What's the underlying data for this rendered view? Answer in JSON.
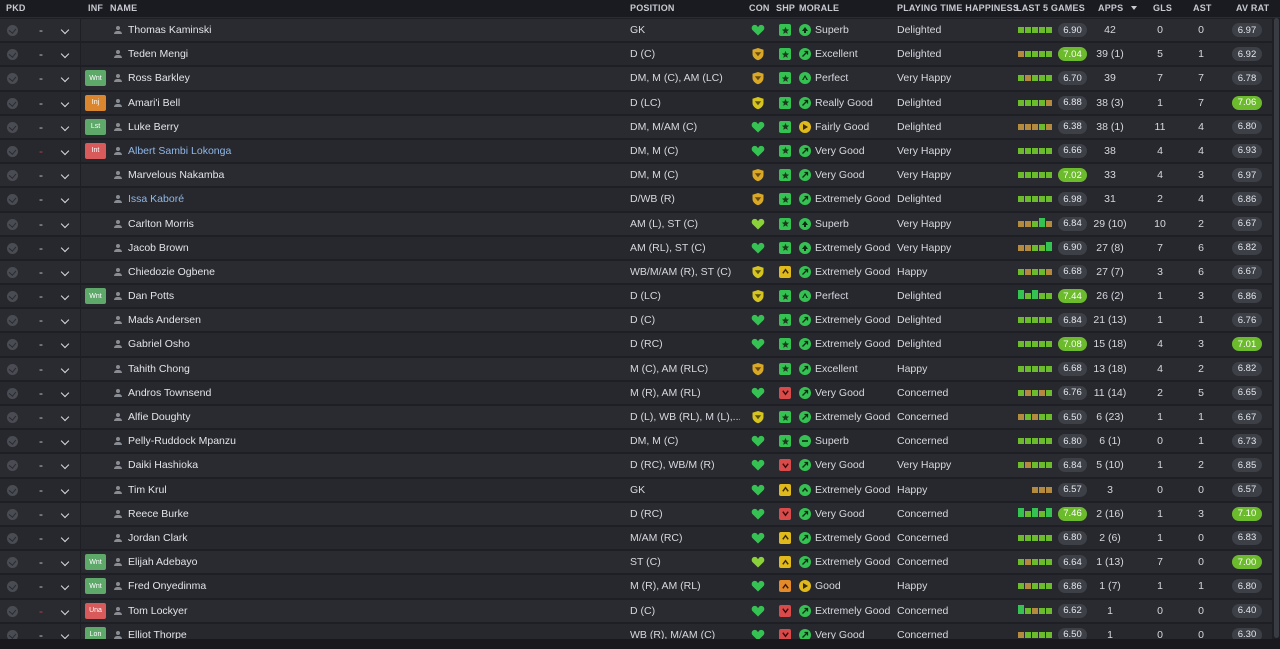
{
  "headers": {
    "pkd": "PKD",
    "inf": "INF",
    "name": "NAME",
    "position": "POSITION",
    "con": "CON",
    "shp": "SHP",
    "morale": "MORALE",
    "pth": "PLAYING TIME HAPPINESS",
    "last5": "LAST 5 GAMES",
    "apps": "APPS",
    "gls": "GLS",
    "ast": "AST",
    "avrat": "AV RAT"
  },
  "colors": {
    "green": "#6cbb2c",
    "bright_green": "#35c253",
    "yellow": "#d8b61a",
    "orange": "#e58a2a",
    "red": "#d94b4b",
    "grey": "#6d6f77",
    "link": "#8fb7e8"
  },
  "players": [
    {
      "pkd_dash": "-",
      "pkd_red": false,
      "inf": "",
      "name": "Thomas Kaminski",
      "link": false,
      "position": "GK",
      "con": "heart",
      "shp": "star-green",
      "morale_icon": "superb",
      "morale": "Superb",
      "pth": "Delighted",
      "form": [
        "g",
        "g",
        "g",
        "g",
        "g"
      ],
      "form_last": "6.90",
      "form_last_green": false,
      "apps": "42",
      "gls": "0",
      "ast": "0",
      "avrat": "6.97",
      "avrat_green": false
    },
    {
      "pkd_dash": "-",
      "pkd_red": false,
      "inf": "",
      "name": "Teden Mengi",
      "link": false,
      "position": "D (C)",
      "con": "shield",
      "shp": "star-green",
      "morale_icon": "good",
      "morale": "Excellent",
      "pth": "Delighted",
      "form": [
        "o",
        "g",
        "g",
        "g",
        "g"
      ],
      "form_last": "7.04",
      "form_last_green": true,
      "apps": "39 (1)",
      "gls": "5",
      "ast": "1",
      "avrat": "6.92",
      "avrat_green": false
    },
    {
      "pkd_dash": "-",
      "pkd_red": false,
      "inf": "Wnt",
      "inf_color": "#5ea86a",
      "name": "Ross Barkley",
      "link": false,
      "position": "DM, M (C), AM (LC)",
      "con": "shield",
      "shp": "star-green",
      "morale_icon": "perfect",
      "morale": "Perfect",
      "pth": "Very Happy",
      "form": [
        "g",
        "o",
        "g",
        "g",
        "g"
      ],
      "form_last": "6.70",
      "form_last_green": false,
      "apps": "39",
      "gls": "7",
      "ast": "7",
      "avrat": "6.78",
      "avrat_green": false
    },
    {
      "pkd_dash": "-",
      "pkd_red": false,
      "inf": "Inj",
      "inf_color": "#d9862f",
      "name": "Amari'i Bell",
      "link": false,
      "position": "D (LC)",
      "con": "shield-y",
      "shp": "star-green",
      "morale_icon": "good",
      "morale": "Really Good",
      "pth": "Delighted",
      "form": [
        "g",
        "g",
        "g",
        "g",
        "o"
      ],
      "form_last": "6.88",
      "form_last_green": false,
      "apps": "38 (3)",
      "gls": "1",
      "ast": "7",
      "avrat": "7.06",
      "avrat_green": true
    },
    {
      "pkd_dash": "-",
      "pkd_red": false,
      "inf": "Lst",
      "inf_color": "#5ea86a",
      "name": "Luke Berry",
      "link": false,
      "position": "DM, M/AM (C)",
      "con": "heart",
      "shp": "star-green",
      "morale_icon": "fairly",
      "morale": "Fairly Good",
      "pth": "Delighted",
      "form": [
        "o",
        "o",
        "o",
        "g",
        "o"
      ],
      "form_last": "6.38",
      "form_last_green": false,
      "apps": "38 (1)",
      "gls": "11",
      "ast": "4",
      "avrat": "6.80",
      "avrat_green": false
    },
    {
      "pkd_dash": "-",
      "pkd_red": true,
      "inf": "Int",
      "inf_color": "#d95a5a",
      "name": "Albert Sambi Lokonga",
      "link": true,
      "position": "DM, M (C)",
      "con": "heart",
      "shp": "star-green",
      "morale_icon": "good",
      "morale": "Very Good",
      "pth": "Very Happy",
      "form": [
        "g",
        "g",
        "g",
        "g",
        "g"
      ],
      "form_last": "6.66",
      "form_last_green": false,
      "apps": "38",
      "gls": "4",
      "ast": "4",
      "avrat": "6.93",
      "avrat_green": false
    },
    {
      "pkd_dash": "-",
      "pkd_red": false,
      "inf": "",
      "name": "Marvelous Nakamba",
      "link": false,
      "position": "DM, M (C)",
      "con": "shield",
      "shp": "star-green",
      "morale_icon": "good",
      "morale": "Very Good",
      "pth": "Very Happy",
      "form": [
        "g",
        "g",
        "g",
        "g",
        "g"
      ],
      "form_last": "7.02",
      "form_last_green": true,
      "apps": "33",
      "gls": "4",
      "ast": "3",
      "avrat": "6.97",
      "avrat_green": false
    },
    {
      "pkd_dash": "-",
      "pkd_red": false,
      "inf": "",
      "name": "Issa Kaboré",
      "link": true,
      "position": "D/WB (R)",
      "con": "shield",
      "shp": "star-green",
      "morale_icon": "good",
      "morale": "Extremely Good",
      "pth": "Delighted",
      "form": [
        "g",
        "g",
        "g",
        "g",
        "g"
      ],
      "form_last": "6.98",
      "form_last_green": false,
      "apps": "31",
      "gls": "2",
      "ast": "4",
      "avrat": "6.86",
      "avrat_green": false
    },
    {
      "pkd_dash": "-",
      "pkd_red": false,
      "inf": "",
      "name": "Carlton Morris",
      "link": false,
      "position": "AM (L), ST (C)",
      "con": "heart-y",
      "shp": "star-green",
      "morale_icon": "superb",
      "morale": "Superb",
      "pth": "Very Happy",
      "form": [
        "o",
        "o",
        "g",
        "G",
        "o"
      ],
      "form_last": "6.84",
      "form_last_green": false,
      "apps": "29 (10)",
      "gls": "10",
      "ast": "2",
      "avrat": "6.67",
      "avrat_green": false
    },
    {
      "pkd_dash": "-",
      "pkd_red": false,
      "inf": "",
      "name": "Jacob Brown",
      "link": false,
      "position": "AM (RL), ST (C)",
      "con": "heart",
      "shp": "star-green",
      "morale_icon": "superb",
      "morale": "Extremely Good",
      "pth": "Very Happy",
      "form": [
        "o",
        "o",
        "g",
        "g",
        "G"
      ],
      "form_last": "6.90",
      "form_last_green": false,
      "apps": "27 (8)",
      "gls": "7",
      "ast": "6",
      "avrat": "6.82",
      "avrat_green": false
    },
    {
      "pkd_dash": "-",
      "pkd_red": false,
      "inf": "",
      "name": "Chiedozie Ogbene",
      "link": false,
      "position": "WB/M/AM (R), ST (C)",
      "con": "shield-y",
      "shp": "up-yellow",
      "morale_icon": "good",
      "morale": "Extremely Good",
      "pth": "Happy",
      "form": [
        "g",
        "o",
        "g",
        "g",
        "o"
      ],
      "form_last": "6.68",
      "form_last_green": false,
      "apps": "27 (7)",
      "gls": "3",
      "ast": "6",
      "avrat": "6.67",
      "avrat_green": false
    },
    {
      "pkd_dash": "-",
      "pkd_red": false,
      "inf": "Wnt",
      "inf_color": "#5ea86a",
      "name": "Dan Potts",
      "link": false,
      "position": "D (LC)",
      "con": "shield-y",
      "shp": "star-green",
      "morale_icon": "perfect",
      "morale": "Perfect",
      "pth": "Delighted",
      "form": [
        "G",
        "g",
        "G",
        "g",
        "g"
      ],
      "form_last": "7.44",
      "form_last_green": true,
      "apps": "26 (2)",
      "gls": "1",
      "ast": "3",
      "avrat": "6.86",
      "avrat_green": false
    },
    {
      "pkd_dash": "-",
      "pkd_red": false,
      "inf": "",
      "name": "Mads Andersen",
      "link": false,
      "position": "D (C)",
      "con": "heart",
      "shp": "star-green",
      "morale_icon": "good",
      "morale": "Extremely Good",
      "pth": "Delighted",
      "form": [
        "g",
        "g",
        "g",
        "g",
        "g"
      ],
      "form_last": "6.84",
      "form_last_green": false,
      "apps": "21 (13)",
      "gls": "1",
      "ast": "1",
      "avrat": "6.76",
      "avrat_green": false
    },
    {
      "pkd_dash": "-",
      "pkd_red": false,
      "inf": "",
      "name": "Gabriel Osho",
      "link": false,
      "position": "D (RC)",
      "con": "heart",
      "shp": "star-green",
      "morale_icon": "good",
      "morale": "Extremely Good",
      "pth": "Delighted",
      "form": [
        "g",
        "g",
        "g",
        "g",
        "g"
      ],
      "form_last": "7.08",
      "form_last_green": true,
      "apps": "15 (18)",
      "gls": "4",
      "ast": "3",
      "avrat": "7.01",
      "avrat_green": true
    },
    {
      "pkd_dash": "-",
      "pkd_red": false,
      "inf": "",
      "name": "Tahith Chong",
      "link": false,
      "position": "M (C), AM (RLC)",
      "con": "shield",
      "shp": "star-green",
      "morale_icon": "good",
      "morale": "Excellent",
      "pth": "Happy",
      "form": [
        "g",
        "g",
        "g",
        "g",
        "g"
      ],
      "form_last": "6.68",
      "form_last_green": false,
      "apps": "13 (18)",
      "gls": "4",
      "ast": "2",
      "avrat": "6.82",
      "avrat_green": false
    },
    {
      "pkd_dash": "-",
      "pkd_red": false,
      "inf": "",
      "name": "Andros Townsend",
      "link": false,
      "position": "M (R), AM (RL)",
      "con": "heart",
      "shp": "down-red",
      "morale_icon": "good",
      "morale": "Very Good",
      "pth": "Concerned",
      "form": [
        "g",
        "o",
        "g",
        "o",
        "g"
      ],
      "form_last": "6.76",
      "form_last_green": false,
      "apps": "11 (14)",
      "gls": "2",
      "ast": "5",
      "avrat": "6.65",
      "avrat_green": false
    },
    {
      "pkd_dash": "-",
      "pkd_red": false,
      "inf": "",
      "name": "Alfie Doughty",
      "link": false,
      "position": "D (L), WB (RL), M (L),...",
      "con": "shield-y",
      "shp": "star-green",
      "morale_icon": "good",
      "morale": "Extremely Good",
      "pth": "Concerned",
      "form": [
        "o",
        "g",
        "o",
        "g",
        "g"
      ],
      "form_last": "6.50",
      "form_last_green": false,
      "apps": "6 (23)",
      "gls": "1",
      "ast": "1",
      "avrat": "6.67",
      "avrat_green": false
    },
    {
      "pkd_dash": "-",
      "pkd_red": false,
      "inf": "",
      "name": "Pelly-Ruddock Mpanzu",
      "link": false,
      "position": "DM, M (C)",
      "con": "heart",
      "shp": "star-green",
      "morale_icon": "neutral",
      "morale": "Superb",
      "pth": "Concerned",
      "form": [
        "g",
        "g",
        "g",
        "g",
        "g"
      ],
      "form_last": "6.80",
      "form_last_green": false,
      "apps": "6 (1)",
      "gls": "0",
      "ast": "1",
      "avrat": "6.73",
      "avrat_green": false
    },
    {
      "pkd_dash": "-",
      "pkd_red": false,
      "inf": "",
      "name": "Daiki Hashioka",
      "link": false,
      "position": "D (RC), WB/M (R)",
      "con": "heart",
      "shp": "down-red",
      "morale_icon": "good",
      "morale": "Very Good",
      "pth": "Very Happy",
      "form": [
        "g",
        "o",
        "g",
        "g",
        "g"
      ],
      "form_last": "6.84",
      "form_last_green": false,
      "apps": "5 (10)",
      "gls": "1",
      "ast": "2",
      "avrat": "6.85",
      "avrat_green": false
    },
    {
      "pkd_dash": "-",
      "pkd_red": false,
      "inf": "",
      "name": "Tim Krul",
      "link": false,
      "position": "GK",
      "con": "heart",
      "shp": "up-yellow",
      "morale_icon": "up-o",
      "morale": "Extremely Good",
      "pth": "Happy",
      "form": [
        "o",
        "o",
        "o"
      ],
      "form_last": "6.57",
      "form_last_green": false,
      "apps": "3",
      "gls": "0",
      "ast": "0",
      "avrat": "6.57",
      "avrat_green": false
    },
    {
      "pkd_dash": "-",
      "pkd_red": false,
      "inf": "",
      "name": "Reece Burke",
      "link": false,
      "position": "D (RC)",
      "con": "heart",
      "shp": "down-red",
      "morale_icon": "good",
      "morale": "Very Good",
      "pth": "Concerned",
      "form": [
        "G",
        "g",
        "G",
        "g",
        "G"
      ],
      "form_last": "7.46",
      "form_last_green": true,
      "apps": "2 (16)",
      "gls": "1",
      "ast": "3",
      "avrat": "7.10",
      "avrat_green": true
    },
    {
      "pkd_dash": "-",
      "pkd_red": false,
      "inf": "",
      "name": "Jordan Clark",
      "link": false,
      "position": "M/AM (RC)",
      "con": "heart",
      "shp": "up-yellow",
      "morale_icon": "good",
      "morale": "Extremely Good",
      "pth": "Concerned",
      "form": [
        "g",
        "g",
        "g",
        "g",
        "g"
      ],
      "form_last": "6.80",
      "form_last_green": false,
      "apps": "2 (6)",
      "gls": "1",
      "ast": "0",
      "avrat": "6.83",
      "avrat_green": false
    },
    {
      "pkd_dash": "-",
      "pkd_red": false,
      "inf": "Wnt",
      "inf_color": "#5ea86a",
      "name": "Elijah Adebayo",
      "link": false,
      "position": "ST (C)",
      "con": "heart-y",
      "shp": "up-yellow",
      "morale_icon": "good",
      "morale": "Extremely Good",
      "pth": "Concerned",
      "form": [
        "g",
        "o",
        "g",
        "g",
        "g"
      ],
      "form_last": "6.64",
      "form_last_green": false,
      "apps": "1 (13)",
      "gls": "7",
      "ast": "0",
      "avrat": "7.00",
      "avrat_green": true
    },
    {
      "pkd_dash": "-",
      "pkd_red": false,
      "inf": "Wnt",
      "inf_color": "#5ea86a",
      "name": "Fred Onyedinma",
      "link": false,
      "position": "M (R), AM (RL)",
      "con": "heart",
      "shp": "up-orange",
      "morale_icon": "fairly",
      "morale": "Good",
      "pth": "Happy",
      "form": [
        "g",
        "o",
        "g",
        "g",
        "g"
      ],
      "form_last": "6.86",
      "form_last_green": false,
      "apps": "1 (7)",
      "gls": "1",
      "ast": "1",
      "avrat": "6.80",
      "avrat_green": false
    },
    {
      "pkd_dash": "-",
      "pkd_red": true,
      "inf": "Una",
      "inf_color": "#d95a5a",
      "name": "Tom Lockyer",
      "link": false,
      "position": "D (C)",
      "con": "heart",
      "shp": "down-red",
      "morale_icon": "good",
      "morale": "Extremely Good",
      "pth": "Concerned",
      "form": [
        "G",
        "g",
        "o",
        "g",
        "g"
      ],
      "form_last": "6.62",
      "form_last_green": false,
      "apps": "1",
      "gls": "0",
      "ast": "0",
      "avrat": "6.40",
      "avrat_green": false
    },
    {
      "pkd_dash": "-",
      "pkd_red": false,
      "inf": "Lon",
      "inf_color": "#5ea86a",
      "name": "Elliot Thorpe",
      "link": false,
      "position": "WB (R), M/AM (C)",
      "con": "heart",
      "shp": "down-red",
      "morale_icon": "good",
      "morale": "Very Good",
      "pth": "Concerned",
      "form": [
        "o",
        "g",
        "g",
        "g",
        "g"
      ],
      "form_last": "6.50",
      "form_last_green": false,
      "apps": "1",
      "gls": "0",
      "ast": "0",
      "avrat": "6.30",
      "avrat_green": false
    }
  ]
}
